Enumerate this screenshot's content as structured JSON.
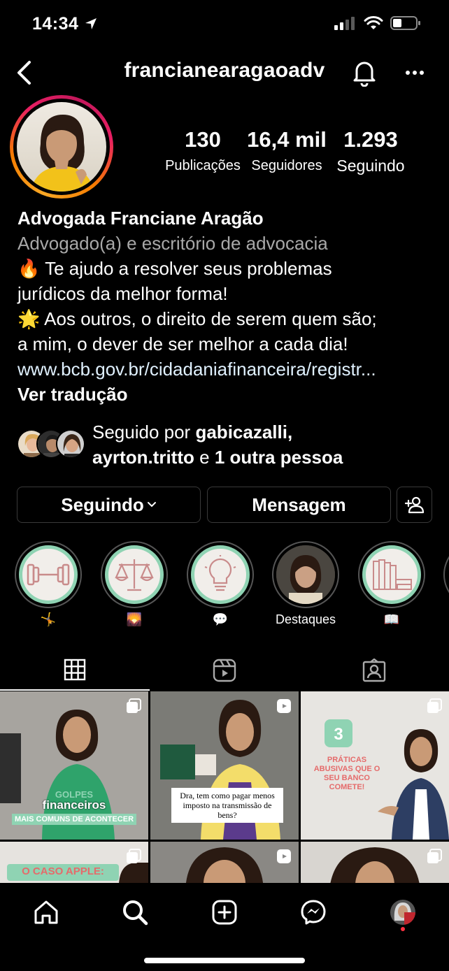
{
  "status_bar": {
    "time": "14:34"
  },
  "header": {
    "username": "francianearagaoadv"
  },
  "profile": {
    "stats": [
      {
        "number": "130",
        "label": "Publicações"
      },
      {
        "number": "16,4 mil",
        "label": "Seguidores"
      },
      {
        "number": "1.293",
        "label": "Seguindo"
      }
    ],
    "name": "Advogada Franciane Aragão",
    "category": "Advogado(a) e escritório de advocacia",
    "bio_lines": [
      "🔥 Te ajudo a resolver seus problemas",
      "jurídicos da melhor forma!",
      "🌟 Aos outros, o direito de serem quem são;",
      "a mim, o dever de ser melhor a cada dia!"
    ],
    "link": "www.bcb.gov.br/cidadaniafinanceira/registr...",
    "translate": "Ver tradução"
  },
  "followed_by": {
    "prefix": "Seguido por",
    "user1": "gabicazalli,",
    "user2": "ayrton.tritto",
    "connector": "e",
    "others": "1 outra pessoa"
  },
  "actions": {
    "following": "Seguindo",
    "message": "Mensagem"
  },
  "highlights": [
    {
      "label": "🤸",
      "icon": "dumbbell-icon"
    },
    {
      "label": "🌄",
      "icon": "scales-icon"
    },
    {
      "label": "💬",
      "icon": "lightbulb-icon"
    },
    {
      "label": "Destaques",
      "icon": "photo"
    },
    {
      "label": "📖",
      "icon": "books-icon"
    }
  ],
  "grid_posts": [
    {
      "title_top": "GOLPES",
      "title_main": "financeiros",
      "title_sub": "MAIS COMUNS DE ACONTECER",
      "type": "carousel"
    },
    {
      "caption": "Dra, tem como pagar menos imposto na transmissão de bens?",
      "type": "reel"
    },
    {
      "number": "3",
      "text": "PRÁTICAS ABUSIVAS QUE O SEU BANCO COMETE!",
      "type": "carousel"
    },
    {
      "text": "O CASO APPLE:",
      "type": "carousel"
    },
    {
      "type": "reel"
    },
    {
      "type": "carousel"
    }
  ],
  "colors": {
    "accent_green": "#8fd3b3",
    "story_ring": "#e91e63",
    "link": "#e0f1ff"
  }
}
